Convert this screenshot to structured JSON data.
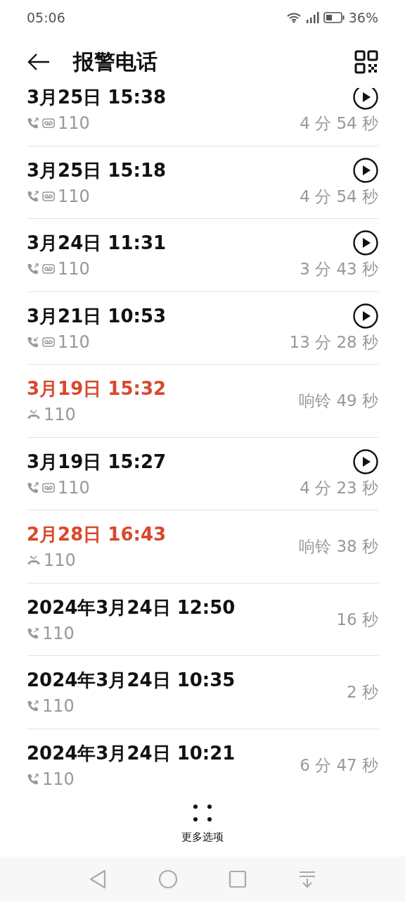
{
  "status_bar": {
    "time": "05:06",
    "battery": "36%"
  },
  "header": {
    "title": "报警电话"
  },
  "calls": [
    {
      "date": "3月25日 15:38",
      "kind": "outgoing",
      "voicemail": true,
      "recording": true,
      "missed": false,
      "number": "110",
      "duration": "4 分 54 秒"
    },
    {
      "date": "3月25日 15:18",
      "kind": "outgoing",
      "voicemail": true,
      "recording": true,
      "missed": false,
      "number": "110",
      "duration": "4 分 54 秒"
    },
    {
      "date": "3月24日 11:31",
      "kind": "outgoing",
      "voicemail": true,
      "recording": true,
      "missed": false,
      "number": "110",
      "duration": "3 分 43 秒"
    },
    {
      "date": "3月21日 10:53",
      "kind": "incoming",
      "voicemail": true,
      "recording": true,
      "missed": false,
      "number": "110",
      "duration": "13 分 28 秒"
    },
    {
      "date": "3月19日 15:32",
      "kind": "missed",
      "voicemail": false,
      "recording": false,
      "missed": true,
      "number": "110",
      "duration": "响铃 49 秒"
    },
    {
      "date": "3月19日 15:27",
      "kind": "outgoing",
      "voicemail": true,
      "recording": true,
      "missed": false,
      "number": "110",
      "duration": "4 分 23 秒"
    },
    {
      "date": "2月28日 16:43",
      "kind": "missed",
      "voicemail": false,
      "recording": false,
      "missed": true,
      "number": "110",
      "duration": "响铃 38 秒"
    },
    {
      "date": "2024年3月24日 12:50",
      "kind": "outgoing",
      "voicemail": false,
      "recording": false,
      "missed": false,
      "number": "110",
      "duration": "16 秒"
    },
    {
      "date": "2024年3月24日 10:35",
      "kind": "outgoing",
      "voicemail": false,
      "recording": false,
      "missed": false,
      "number": "110",
      "duration": "2 秒"
    },
    {
      "date": "2024年3月24日 10:21",
      "kind": "outgoing",
      "voicemail": false,
      "recording": false,
      "missed": false,
      "number": "110",
      "duration": "6 分 47 秒"
    }
  ],
  "more_button": {
    "label": "更多选项"
  }
}
